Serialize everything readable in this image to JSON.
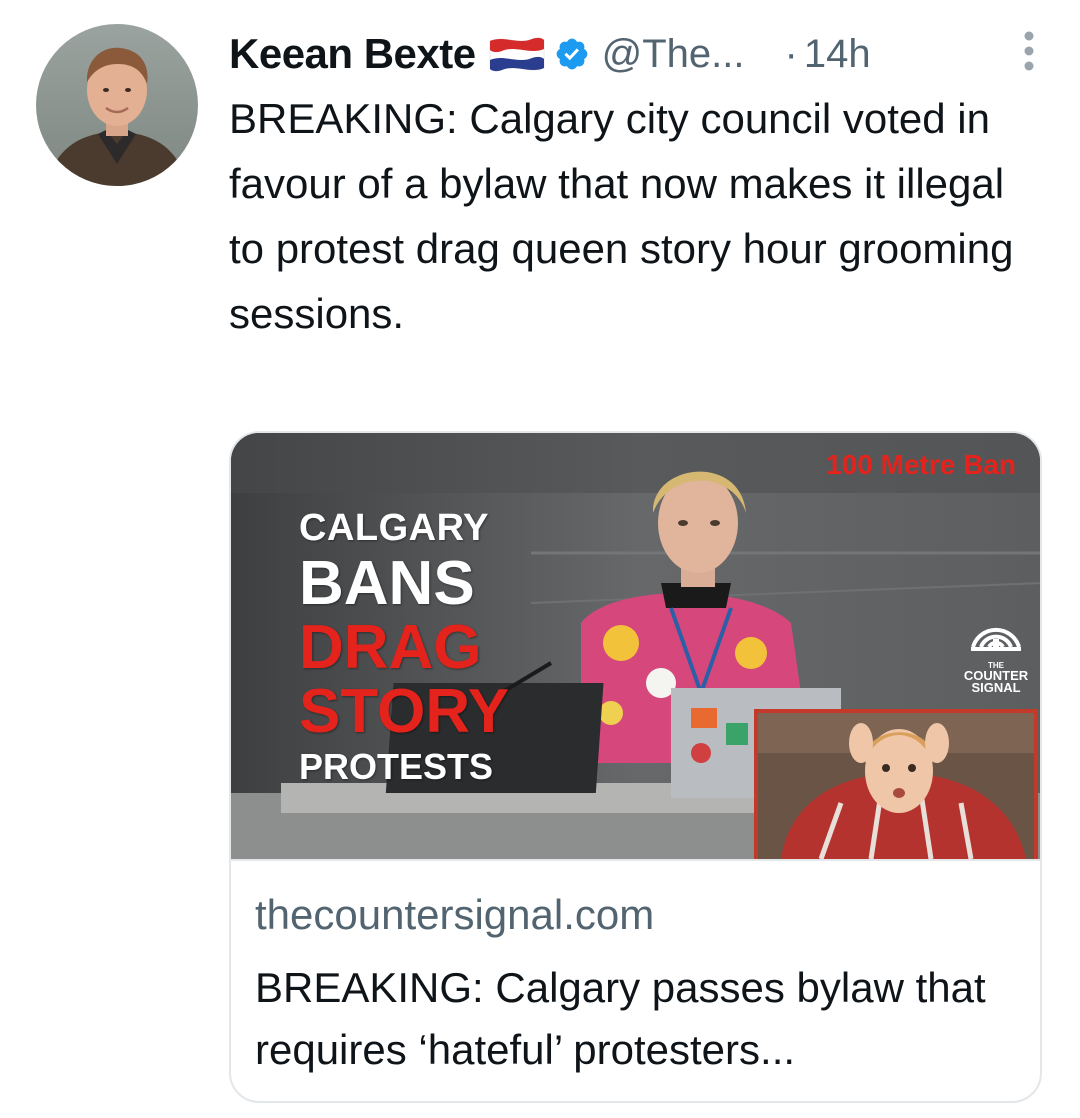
{
  "tweet": {
    "display_name": "Keean Bexte",
    "handle": "@The...",
    "separator": "·",
    "time": "14h",
    "text": "BREAKING: Calgary city council voted in favour of a bylaw that now makes it illegal to protest drag queen story hour grooming sessions.",
    "icons": {
      "flag": "netherlands-flag-icon",
      "verified": "verified-badge-icon",
      "more": "more-options-icon"
    },
    "colors": {
      "verified": "#1d9bf0",
      "secondary_text": "#536471"
    }
  },
  "card": {
    "thumbnail": {
      "line1": "CALGARY",
      "line2": "BANS",
      "line3": "DRAG",
      "line4": "STORY",
      "line5": "PROTESTS",
      "ban_label": "100 Metre Ban",
      "logo_small": "THE",
      "logo_line1": "COUNTER",
      "logo_line2": "SIGNAL",
      "accent": "#e3231c"
    },
    "domain": "thecountersignal.com",
    "title": "BREAKING: Calgary passes bylaw that requires ‘hateful’ protesters..."
  }
}
